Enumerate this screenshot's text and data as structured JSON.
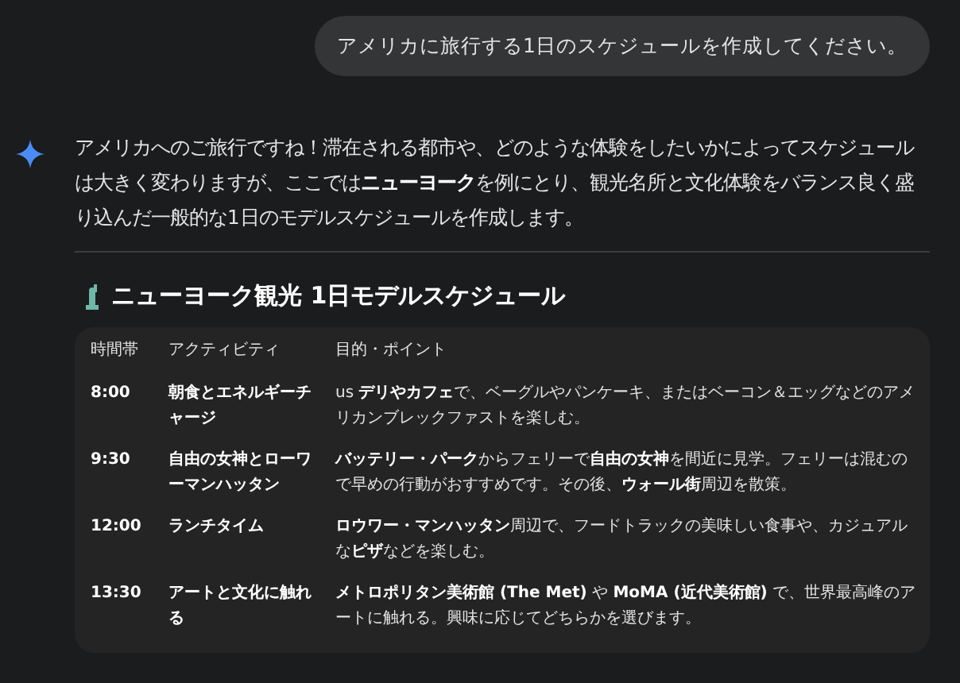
{
  "user_message": "アメリカに旅行する1日のスケジュールを作成してください。",
  "response": {
    "intro": "アメリカへのご旅行ですね！滞在される都市や、どのような体験をしたいかによってスケジュールは大きく変わりますが、ここでは**ニューヨーク**を例にとり、観光名所と文化体験をバランス良く盛り込んだ一般的な1日のモデルスケジュールを作成します。",
    "heading": "ニューヨーク観光 1日モデルスケジュール",
    "table": {
      "columns": [
        "時間帯",
        "アクティビティ",
        "目的・ポイント"
      ],
      "rows": [
        {
          "time": "8:00",
          "activity": "朝食とエネルギーチャージ",
          "point": "us **デリやカフェ**で、ベーグルやパンケーキ、またはベーコン＆エッグなどのアメリカンブレックファストを楽しむ。"
        },
        {
          "time": "9:30",
          "activity": "自由の女神とローワーマンハッタン",
          "point": "**バッテリー・パーク**からフェリーで**自由の女神**を間近に見学。フェリーは混むので早めの行動がおすすめです。その後、**ウォール街**周辺を散策。"
        },
        {
          "time": "12:00",
          "activity": "ランチタイム",
          "point": "**ロウワー・マンハッタン**周辺で、フードトラックの美味しい食事や、カジュアルな**ピザ**などを楽しむ。"
        },
        {
          "time": "13:30",
          "activity": "アートと文化に触れる",
          "point": "**メトロポリタン美術館 (The Met)** や **MoMA (近代美術館)** で、世界最高峰のアートに触れる。興味に応じてどちらかを選びます。"
        }
      ]
    }
  }
}
